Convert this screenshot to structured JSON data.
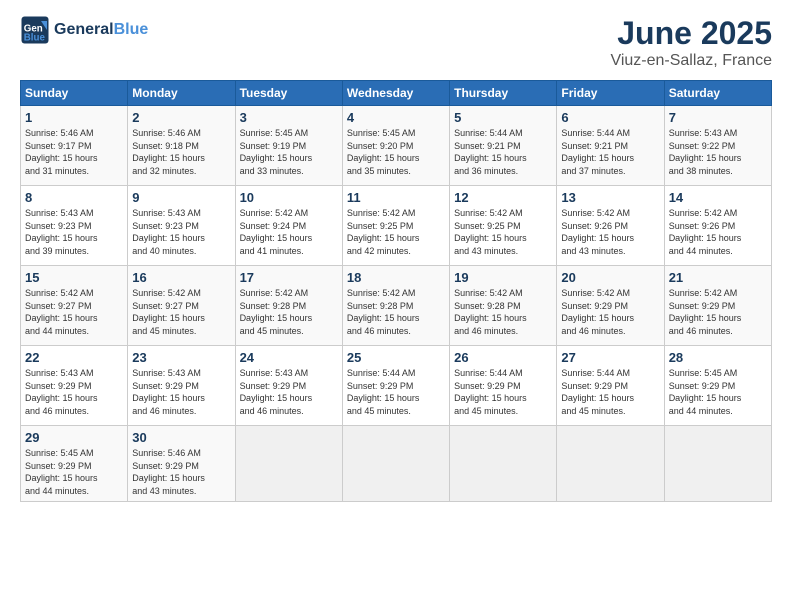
{
  "header": {
    "logo_line1": "General",
    "logo_line2": "Blue",
    "title": "June 2025",
    "subtitle": "Viuz-en-Sallaz, France"
  },
  "columns": [
    "Sunday",
    "Monday",
    "Tuesday",
    "Wednesday",
    "Thursday",
    "Friday",
    "Saturday"
  ],
  "weeks": [
    [
      {
        "day": "1",
        "sunrise": "5:46 AM",
        "sunset": "9:17 PM",
        "daylight": "15 hours and 31 minutes."
      },
      {
        "day": "2",
        "sunrise": "5:46 AM",
        "sunset": "9:18 PM",
        "daylight": "15 hours and 32 minutes."
      },
      {
        "day": "3",
        "sunrise": "5:45 AM",
        "sunset": "9:19 PM",
        "daylight": "15 hours and 33 minutes."
      },
      {
        "day": "4",
        "sunrise": "5:45 AM",
        "sunset": "9:20 PM",
        "daylight": "15 hours and 35 minutes."
      },
      {
        "day": "5",
        "sunrise": "5:44 AM",
        "sunset": "9:21 PM",
        "daylight": "15 hours and 36 minutes."
      },
      {
        "day": "6",
        "sunrise": "5:44 AM",
        "sunset": "9:21 PM",
        "daylight": "15 hours and 37 minutes."
      },
      {
        "day": "7",
        "sunrise": "5:43 AM",
        "sunset": "9:22 PM",
        "daylight": "15 hours and 38 minutes."
      }
    ],
    [
      {
        "day": "8",
        "sunrise": "5:43 AM",
        "sunset": "9:23 PM",
        "daylight": "15 hours and 39 minutes."
      },
      {
        "day": "9",
        "sunrise": "5:43 AM",
        "sunset": "9:23 PM",
        "daylight": "15 hours and 40 minutes."
      },
      {
        "day": "10",
        "sunrise": "5:42 AM",
        "sunset": "9:24 PM",
        "daylight": "15 hours and 41 minutes."
      },
      {
        "day": "11",
        "sunrise": "5:42 AM",
        "sunset": "9:25 PM",
        "daylight": "15 hours and 42 minutes."
      },
      {
        "day": "12",
        "sunrise": "5:42 AM",
        "sunset": "9:25 PM",
        "daylight": "15 hours and 43 minutes."
      },
      {
        "day": "13",
        "sunrise": "5:42 AM",
        "sunset": "9:26 PM",
        "daylight": "15 hours and 43 minutes."
      },
      {
        "day": "14",
        "sunrise": "5:42 AM",
        "sunset": "9:26 PM",
        "daylight": "15 hours and 44 minutes."
      }
    ],
    [
      {
        "day": "15",
        "sunrise": "5:42 AM",
        "sunset": "9:27 PM",
        "daylight": "15 hours and 44 minutes."
      },
      {
        "day": "16",
        "sunrise": "5:42 AM",
        "sunset": "9:27 PM",
        "daylight": "15 hours and 45 minutes."
      },
      {
        "day": "17",
        "sunrise": "5:42 AM",
        "sunset": "9:28 PM",
        "daylight": "15 hours and 45 minutes."
      },
      {
        "day": "18",
        "sunrise": "5:42 AM",
        "sunset": "9:28 PM",
        "daylight": "15 hours and 46 minutes."
      },
      {
        "day": "19",
        "sunrise": "5:42 AM",
        "sunset": "9:28 PM",
        "daylight": "15 hours and 46 minutes."
      },
      {
        "day": "20",
        "sunrise": "5:42 AM",
        "sunset": "9:29 PM",
        "daylight": "15 hours and 46 minutes."
      },
      {
        "day": "21",
        "sunrise": "5:42 AM",
        "sunset": "9:29 PM",
        "daylight": "15 hours and 46 minutes."
      }
    ],
    [
      {
        "day": "22",
        "sunrise": "5:43 AM",
        "sunset": "9:29 PM",
        "daylight": "15 hours and 46 minutes."
      },
      {
        "day": "23",
        "sunrise": "5:43 AM",
        "sunset": "9:29 PM",
        "daylight": "15 hours and 46 minutes."
      },
      {
        "day": "24",
        "sunrise": "5:43 AM",
        "sunset": "9:29 PM",
        "daylight": "15 hours and 46 minutes."
      },
      {
        "day": "25",
        "sunrise": "5:44 AM",
        "sunset": "9:29 PM",
        "daylight": "15 hours and 45 minutes."
      },
      {
        "day": "26",
        "sunrise": "5:44 AM",
        "sunset": "9:29 PM",
        "daylight": "15 hours and 45 minutes."
      },
      {
        "day": "27",
        "sunrise": "5:44 AM",
        "sunset": "9:29 PM",
        "daylight": "15 hours and 45 minutes."
      },
      {
        "day": "28",
        "sunrise": "5:45 AM",
        "sunset": "9:29 PM",
        "daylight": "15 hours and 44 minutes."
      }
    ],
    [
      {
        "day": "29",
        "sunrise": "5:45 AM",
        "sunset": "9:29 PM",
        "daylight": "15 hours and 44 minutes."
      },
      {
        "day": "30",
        "sunrise": "5:46 AM",
        "sunset": "9:29 PM",
        "daylight": "15 hours and 43 minutes."
      },
      null,
      null,
      null,
      null,
      null
    ]
  ],
  "labels": {
    "sunrise": "Sunrise:",
    "sunset": "Sunset:",
    "daylight": "Daylight:"
  }
}
